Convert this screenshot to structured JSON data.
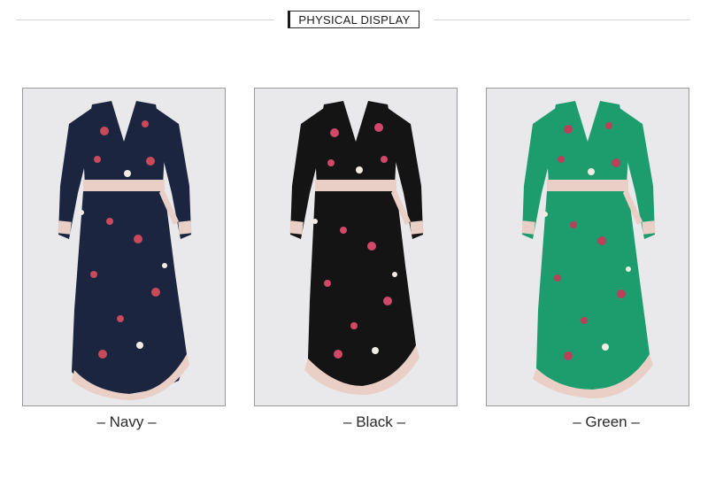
{
  "header": {
    "title": "PHYSICAL DISPLAY"
  },
  "products": [
    {
      "color_name": "Navy",
      "caption": "– Navy –",
      "base_color": "#1c2540",
      "accent_color": "#c94a5a"
    },
    {
      "color_name": "Black",
      "caption": "– Black –",
      "base_color": "#141414",
      "accent_color": "#d2486a"
    },
    {
      "color_name": "Green",
      "caption": "– Green –",
      "base_color": "#1d9d6e",
      "accent_color": "#b8405a"
    }
  ]
}
